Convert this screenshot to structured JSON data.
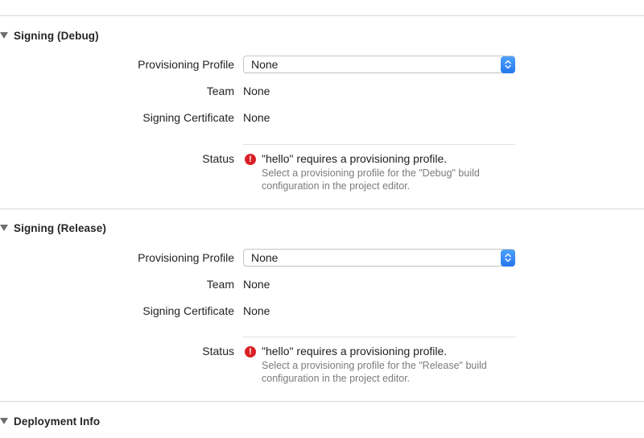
{
  "sections": [
    {
      "title": "Signing (Debug)",
      "provisioning_profile_label": "Provisioning Profile",
      "provisioning_profile_value": "None",
      "team_label": "Team",
      "team_value": "None",
      "cert_label": "Signing Certificate",
      "cert_value": "None",
      "status_label": "Status",
      "status_title": "\"hello\" requires a provisioning profile.",
      "status_detail_line1": "Select a provisioning profile for the \"Debug\" build",
      "status_detail_line2": "configuration in the project editor."
    },
    {
      "title": "Signing (Release)",
      "provisioning_profile_label": "Provisioning Profile",
      "provisioning_profile_value": "None",
      "team_label": "Team",
      "team_value": "None",
      "cert_label": "Signing Certificate",
      "cert_value": "None",
      "status_label": "Status",
      "status_title": "\"hello\" requires a provisioning profile.",
      "status_detail_line1": "Select a provisioning profile for the \"Release\" build",
      "status_detail_line2": "configuration in the project editor."
    },
    {
      "title": "Deployment Info"
    }
  ],
  "icons": {
    "disclosure": "disclosure-triangle-icon",
    "error": "error-icon",
    "popup_arrows": "chevron-updown-icon"
  },
  "error_symbol": "!",
  "colors": {
    "accent": "#2f7ff1",
    "error": "#dc1f26"
  }
}
